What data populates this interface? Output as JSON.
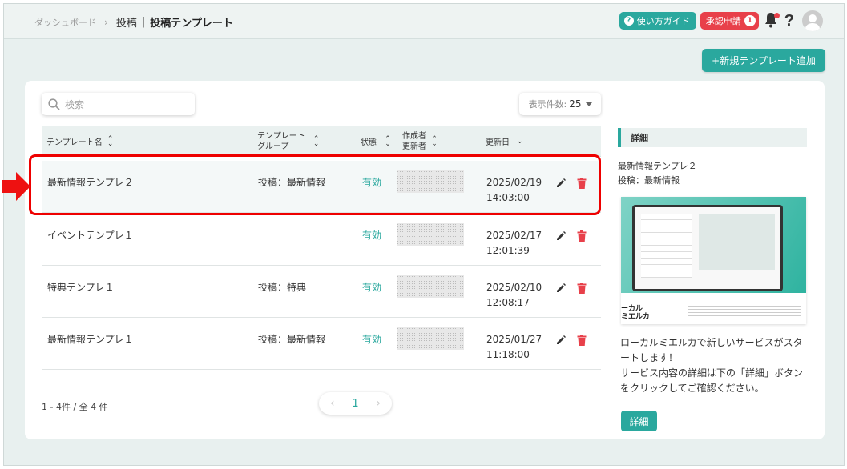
{
  "breadcrumb": {
    "dashboard": "ダッシュボード",
    "section": "投稿",
    "separator": "|",
    "current": "投稿テンプレート"
  },
  "header": {
    "guide_label": "使い方ガイド",
    "approve_label": "承認申請",
    "approve_count": "1",
    "help_glyph": "?"
  },
  "toolbar": {
    "add_label": "+新規テンプレート追加"
  },
  "search": {
    "placeholder": "検索"
  },
  "perpage": {
    "label": "表示件数:",
    "value": "25"
  },
  "table": {
    "columns": {
      "name": "テンプレート名",
      "group_l1": "テンプレート",
      "group_l2": "グループ",
      "status": "状態",
      "author_l1": "作成者",
      "author_l2": "更新者",
      "updated": "更新日"
    },
    "rows": [
      {
        "name": "最新情報テンプレ２",
        "group": "投稿：最新情報",
        "status": "有効",
        "date": "2025/02/19",
        "time": "14:03:00"
      },
      {
        "name": "イベントテンプレ１",
        "group": "",
        "status": "有効",
        "date": "2025/02/17",
        "time": "12:01:39"
      },
      {
        "name": "特典テンプレ１",
        "group": "投稿：特典",
        "status": "有効",
        "date": "2025/02/10",
        "time": "12:08:17"
      },
      {
        "name": "最新情報テンプレ１",
        "group": "投稿：最新情報",
        "status": "有効",
        "date": "2025/01/27",
        "time": "11:18:00"
      }
    ]
  },
  "footer": {
    "count": "1 - 4件 / 全 4 件",
    "page": "1"
  },
  "detail": {
    "title": "詳細",
    "name": "最新情報テンプレ２",
    "group": "投稿：最新情報",
    "thumb_line1": "ーカル",
    "thumb_line2": "ミエルカ",
    "desc_l1": "ローカルミエルカで新しいサービスがスタートします！",
    "desc_l2": "サービス内容の詳細は下の「詳細」ボタンをクリックしてご確認ください。",
    "button": "詳細"
  },
  "colors": {
    "accent": "#2aa89e",
    "danger": "#e8404a",
    "highlight": "#e00000"
  },
  "icons": {
    "search": "search-icon",
    "edit": "pencil-icon",
    "delete": "trash-icon",
    "bell": "bell-icon",
    "sort": "sort-icon",
    "arrow": "arrow-right-icon"
  }
}
